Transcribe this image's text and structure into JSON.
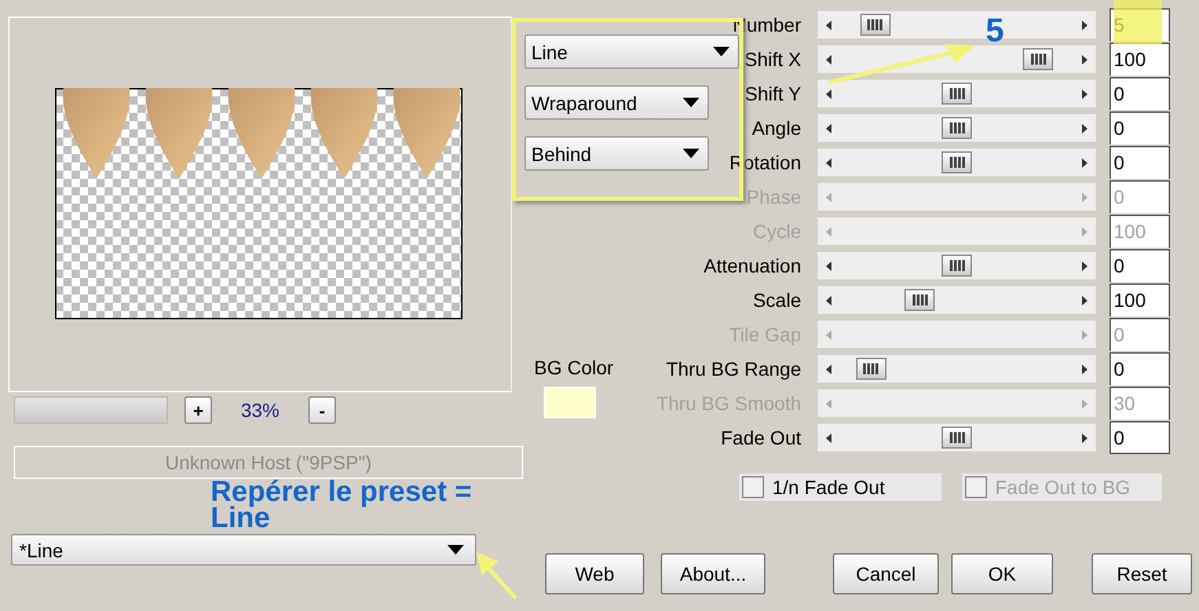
{
  "preview": {
    "zoom_out": "-",
    "zoom": "33%",
    "zoom_in": "+",
    "host": "Unknown Host (\"9PSP\")"
  },
  "dropdowns": [
    {
      "value": "Line"
    },
    {
      "value": "Wraparound"
    },
    {
      "value": "Behind"
    }
  ],
  "bg_color": {
    "label": "BG Color",
    "color": "#ffffcc"
  },
  "sliders": [
    {
      "label": "Number",
      "value": "5",
      "disabled": false
    },
    {
      "label": "Shift X",
      "value": "100",
      "disabled": false
    },
    {
      "label": "Shift Y",
      "value": "0",
      "disabled": false
    },
    {
      "label": "Angle",
      "value": "0",
      "disabled": false
    },
    {
      "label": "Rotation",
      "value": "0",
      "disabled": false
    },
    {
      "label": "Phase",
      "value": "0",
      "disabled": true
    },
    {
      "label": "Cycle",
      "value": "100",
      "disabled": true
    },
    {
      "label": "Attenuation",
      "value": "0",
      "disabled": false
    },
    {
      "label": "Scale",
      "value": "100",
      "disabled": false
    },
    {
      "label": "Tile Gap",
      "value": "0",
      "disabled": true
    },
    {
      "label": "Thru BG Range",
      "value": "0",
      "disabled": false
    },
    {
      "label": "Thru BG Smooth",
      "value": "30",
      "disabled": true
    },
    {
      "label": "Fade Out",
      "value": "0",
      "disabled": false
    }
  ],
  "checkboxes": [
    {
      "label": "1/n Fade Out",
      "checked": false,
      "disabled": false
    },
    {
      "label": "Fade Out to BG",
      "checked": false,
      "disabled": true
    }
  ],
  "preset": {
    "value": "*Line"
  },
  "buttons": [
    "Web",
    "About...",
    "Cancel",
    "OK",
    "Reset"
  ],
  "annotations": [
    {
      "kind": "number",
      "text": "5"
    },
    {
      "kind": "note",
      "text": "Repérer le preset = Line"
    }
  ]
}
